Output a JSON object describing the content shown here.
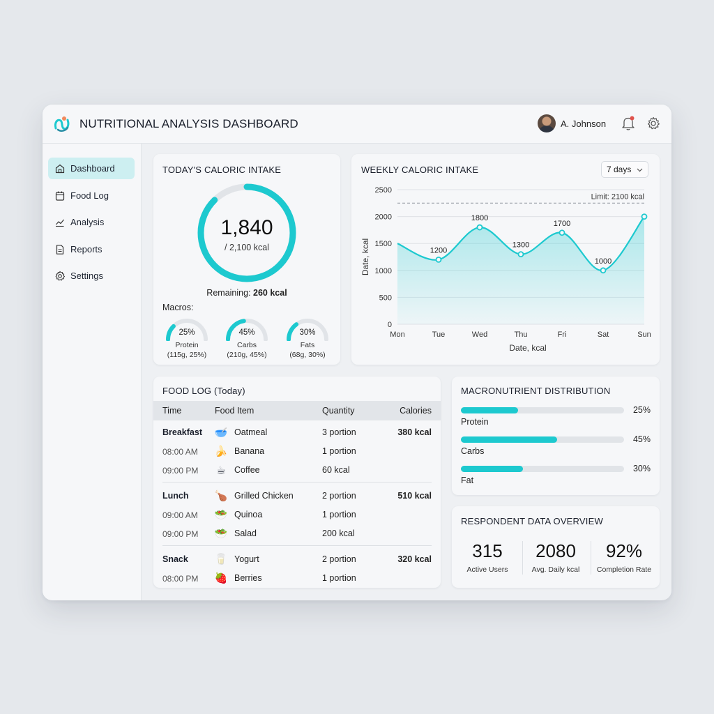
{
  "app": {
    "title": "NUTRITIONAL ANALYSIS DASHBOARD",
    "user_name": "A. Johnson",
    "icons": [
      "logo-icon",
      "bell-icon",
      "gear-icon"
    ],
    "accent": "#1dc9cf",
    "notification_dot": "#e0524c"
  },
  "sidebar": {
    "items": [
      {
        "label": "Dashboard",
        "icon": "home-icon",
        "active": true
      },
      {
        "label": "Food Log",
        "icon": "calendar-icon"
      },
      {
        "label": "Analysis",
        "icon": "trend-icon"
      },
      {
        "label": "Reports",
        "icon": "document-icon"
      },
      {
        "label": "Settings",
        "icon": "gear-icon"
      }
    ]
  },
  "today": {
    "title": "TODAY'S CALORIC INTAKE",
    "consumed": "1,840",
    "goal": "/ 2,100 kcal",
    "remaining_label": "Remaining:",
    "remaining_value": "260 kcal",
    "macros_label": "Macros:",
    "macros": [
      {
        "pct": "25%",
        "fraction": 0.25,
        "name": "Protein",
        "detail": "(115g, 25%)"
      },
      {
        "pct": "45%",
        "fraction": 0.45,
        "name": "Carbs",
        "detail": "(210g, 45%)"
      },
      {
        "pct": "30%",
        "fraction": 0.3,
        "name": "Fats",
        "detail": "(68g, 30%)"
      }
    ],
    "progress_fraction": 0.876
  },
  "weekly": {
    "title": "WEEKLY CALORIC INTAKE",
    "range": "7 days"
  },
  "chart_data": {
    "type": "area",
    "title": "WEEKLY CALORIC INTAKE",
    "categories": [
      "Mon",
      "Tue",
      "Wed",
      "Thu",
      "Fri",
      "Sat",
      "Sun"
    ],
    "values": [
      1500,
      1200,
      1800,
      1300,
      1700,
      1000,
      2000
    ],
    "data_labels": [
      "",
      "1200",
      "1800",
      "1300",
      "1700",
      "1000",
      ""
    ],
    "yticks": [
      "0",
      "500",
      "1000",
      "1500",
      "2000",
      "2500"
    ],
    "ylim": [
      0,
      2500
    ],
    "ylabel": "Date, kcal",
    "xlabel": "Date, kcal",
    "limit_value": 2250,
    "limit_label": "Limit: 2100 kcal",
    "grid": true
  },
  "food_log": {
    "title": "FOOD LOG",
    "title_suffix": "(Today)",
    "headers": {
      "time": "Time",
      "item": "Food Item",
      "qty": "Quantity",
      "cal": "Calories"
    },
    "groups": [
      {
        "meal": "Breakfast",
        "kcal": "380 kcal",
        "items": [
          {
            "time": "",
            "emoji": "🥣",
            "food": "Oatmeal",
            "qty": "3 portion"
          },
          {
            "time": "08:00 AM",
            "emoji": "🍌",
            "food": "Banana",
            "qty": "1 portion"
          },
          {
            "time": "09:00 PM",
            "emoji": "☕",
            "food": "Coffee",
            "qty": "60 kcal"
          }
        ]
      },
      {
        "meal": "Lunch",
        "kcal": "510 kcal",
        "items": [
          {
            "time": "",
            "emoji": "🍗",
            "food": "Grilled Chicken",
            "qty": "2 portion"
          },
          {
            "time": "09:00 AM",
            "emoji": "🥗",
            "food": "Quinoa",
            "qty": "1 portion"
          },
          {
            "time": "09:00 PM",
            "emoji": "🥗",
            "food": "Salad",
            "qty": "200 kcal"
          }
        ]
      },
      {
        "meal": "Snack",
        "kcal": "320 kcal",
        "items": [
          {
            "time": "",
            "emoji": "🥛",
            "food": "Yogurt",
            "qty": "2 portion"
          },
          {
            "time": "08:00 PM",
            "emoji": "🍓",
            "food": "Berries",
            "qty": "1 portion"
          }
        ]
      }
    ]
  },
  "macro_dist": {
    "title": "MACRONUTRIENT DISTRIBUTION",
    "rows": [
      {
        "label": "Protein",
        "pct": "25%",
        "fraction": 0.35
      },
      {
        "label": "Carbs",
        "pct": "45%",
        "fraction": 0.59
      },
      {
        "label": "Fat",
        "pct": "30%",
        "fraction": 0.38
      }
    ]
  },
  "respondent": {
    "title": "RESPONDENT DATA OVERVIEW",
    "stats": [
      {
        "value": "315",
        "label": "Active Users"
      },
      {
        "value": "2080",
        "label": "Avg. Daily kcal"
      },
      {
        "value": "92%",
        "label": "Completion Rate"
      }
    ]
  }
}
